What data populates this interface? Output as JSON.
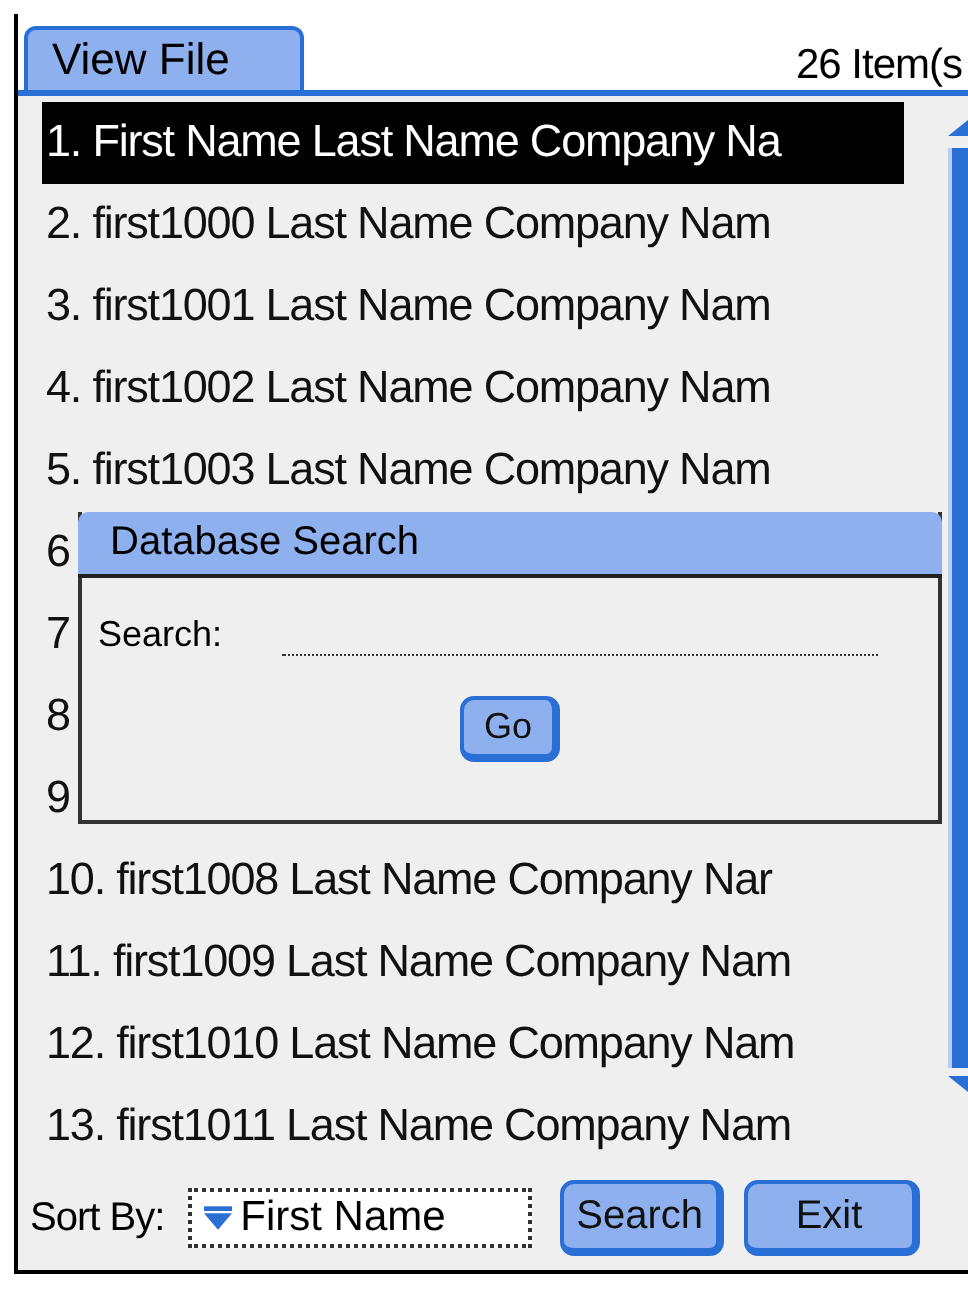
{
  "header": {
    "tab": "View File",
    "count": "26 Item(s"
  },
  "rows": [
    {
      "text": "1. First Name Last Name  Company Na",
      "selected": true
    },
    {
      "text": "2. first1000 Last Name  Company Nam",
      "selected": false
    },
    {
      "text": "3. first1001 Last Name  Company Nam",
      "selected": false
    },
    {
      "text": "4. first1002 Last Name  Company Nam",
      "selected": false
    },
    {
      "text": "5. first1003 Last Name  Company Nam",
      "selected": false
    },
    {
      "text": "6",
      "selected": false
    },
    {
      "text": "7",
      "selected": false
    },
    {
      "text": "8",
      "selected": false
    },
    {
      "text": "9",
      "selected": false
    },
    {
      "text": "10. first1008 Last Name  Company Nar",
      "selected": false
    },
    {
      "text": "11. first1009 Last Name  Company Nam",
      "selected": false
    },
    {
      "text": "12. first1010 Last Name  Company Nam",
      "selected": false
    },
    {
      "text": "13. first1011 Last Name  Company Nam",
      "selected": false
    }
  ],
  "dialog": {
    "title": "Database Search",
    "label": "Search:",
    "button": "Go"
  },
  "footer": {
    "sort_label": "Sort By:",
    "sort_value": "First Name",
    "buttons": [
      "Search",
      "Exit"
    ]
  }
}
